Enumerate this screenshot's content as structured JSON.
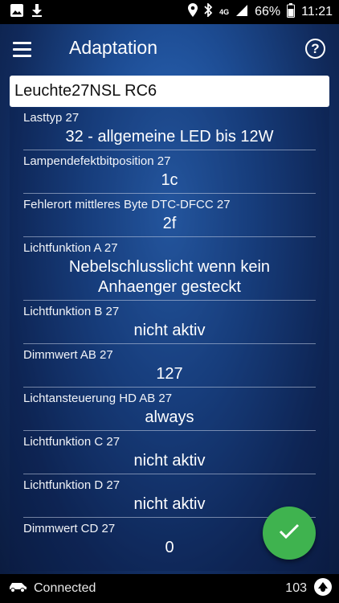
{
  "status_bar": {
    "network": "4G",
    "battery": "66%",
    "time": "11:21"
  },
  "toolbar": {
    "title": "Adaptation",
    "help_label": "?"
  },
  "header_field": {
    "value": "Leuchte27NSL RC6"
  },
  "items": [
    {
      "label": "Lasttyp 27",
      "value": "32 - allgemeine LED bis 12W"
    },
    {
      "label": "Lampendefektbitposition 27",
      "value": "1c"
    },
    {
      "label": "Fehlerort mittleres Byte DTC-DFCC 27",
      "value": "2f"
    },
    {
      "label": "Lichtfunktion A 27",
      "value": "Nebelschlusslicht wenn kein",
      "value2": "Anhaenger gesteckt"
    },
    {
      "label": "Lichtfunktion B 27",
      "value": "nicht aktiv"
    },
    {
      "label": "Dimmwert AB 27",
      "value": "127"
    },
    {
      "label": "Lichtansteuerung HD AB 27",
      "value": "always"
    },
    {
      "label": "Lichtfunktion C 27",
      "value": "nicht aktiv"
    },
    {
      "label": "Lichtfunktion D 27",
      "value": "nicht aktiv"
    },
    {
      "label": "Dimmwert CD 27",
      "value": "0"
    }
  ],
  "bottom_bar": {
    "connection_status": "Connected",
    "count": "103"
  },
  "colors": {
    "fab": "#3fb34f",
    "bar": "#000000"
  }
}
